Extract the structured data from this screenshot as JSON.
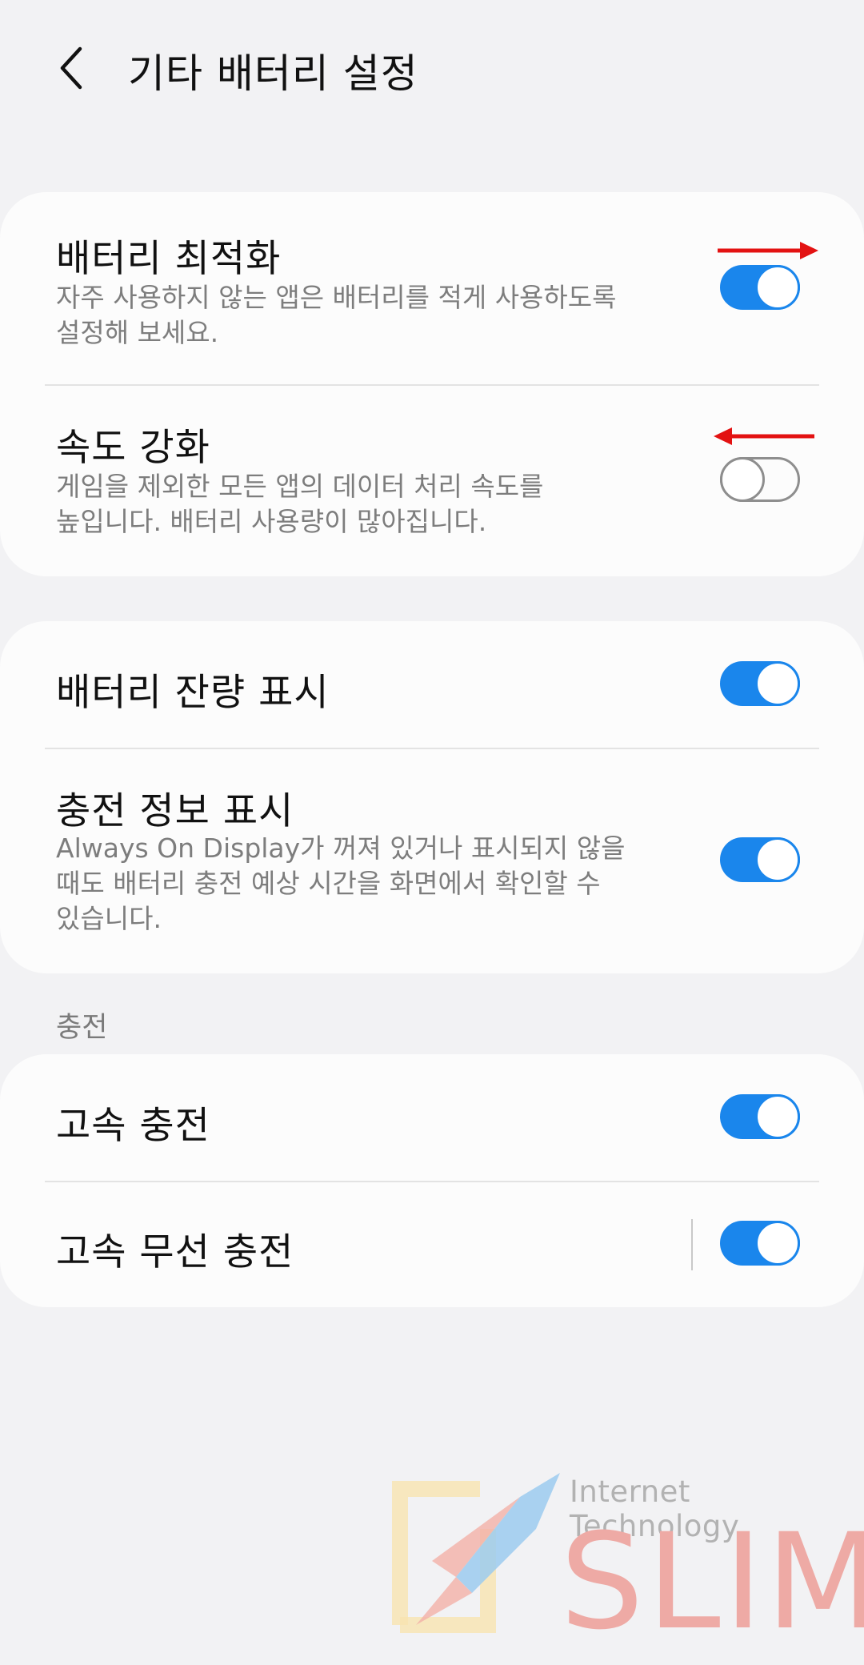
{
  "header": {
    "title": "기타 배터리 설정",
    "back_icon": "chevron-left-icon"
  },
  "groups": [
    {
      "items": [
        {
          "title": "배터리 최적화",
          "subtitle_lines": [
            "자주 사용하지 않는 앱은 배터리를 적게 사용하도록",
            "설정해 보세요."
          ],
          "enabled": true
        },
        {
          "title": "속도 강화",
          "subtitle_lines": [
            "게임을 제외한 모든 앱의 데이터 처리 속도를",
            "높입니다. 배터리 사용량이 많아집니다."
          ],
          "enabled": false
        }
      ]
    },
    {
      "items": [
        {
          "title": "배터리 잔량 표시",
          "enabled": true
        },
        {
          "title": "충전 정보 표시",
          "subtitle_lines": [
            "Always On Display가 꺼져 있거나 표시되지 않을",
            "때도 배터리 충전 예상 시간을 화면에서 확인할 수",
            "있습니다."
          ],
          "enabled": true
        }
      ]
    },
    {
      "section_label": "충전",
      "items": [
        {
          "title": "고속 충전",
          "enabled": true
        },
        {
          "title": "고속 무선 충전",
          "enabled": true
        }
      ]
    }
  ],
  "annotations": {
    "arrow_color": "#e31212",
    "arrows": [
      "arrow-right",
      "arrow-left"
    ]
  },
  "watermark": {
    "caption": "Internet Technology",
    "brand": "SLIM"
  },
  "colors": {
    "accent": "#1a86ec",
    "background": "#f2f2f4",
    "card": "#fcfcfc"
  }
}
